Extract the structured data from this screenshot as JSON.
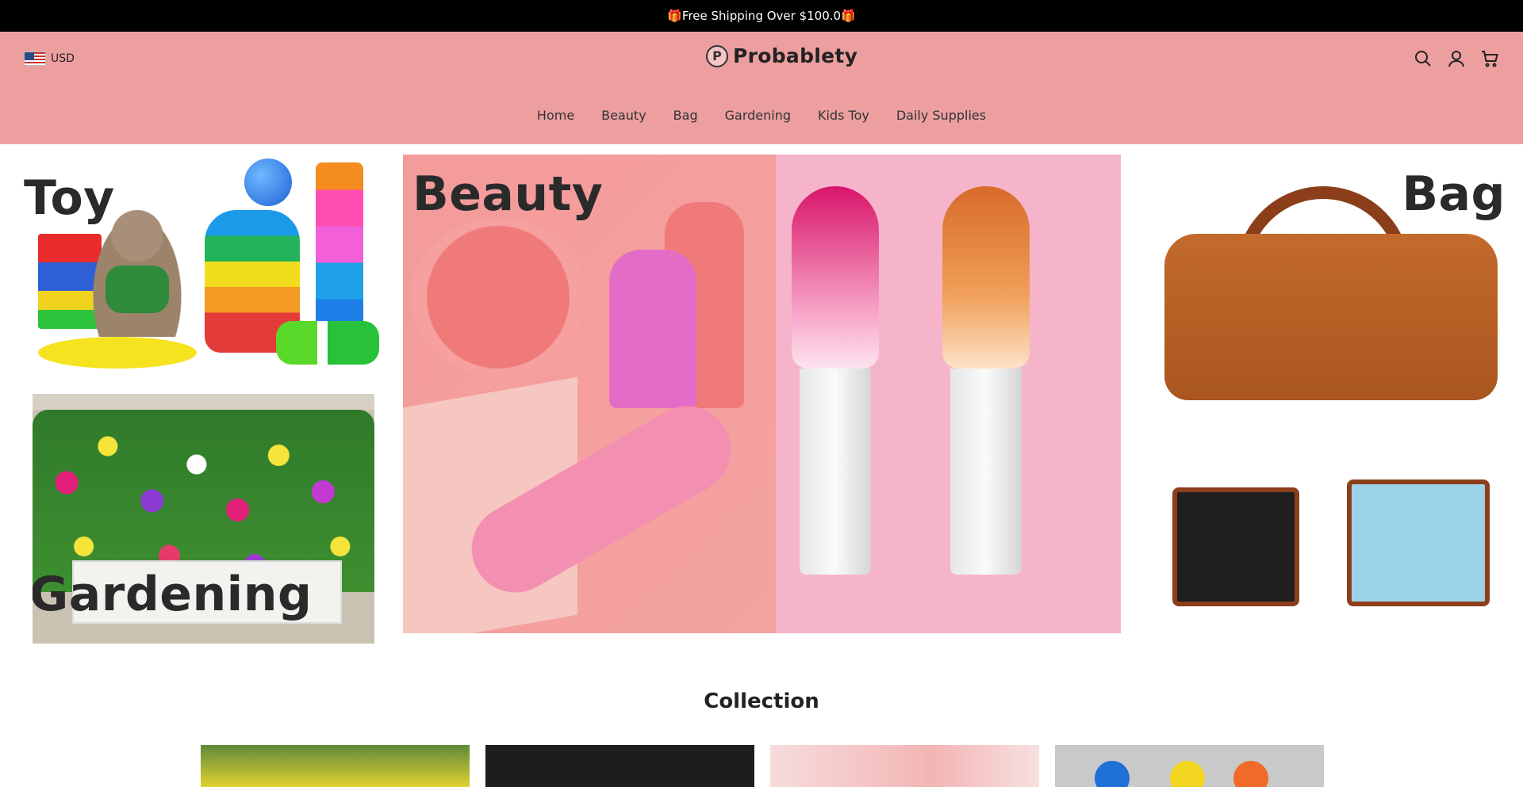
{
  "announcement": {
    "text": "🎁Free Shipping Over $100.0🎁"
  },
  "header": {
    "currency": "USD",
    "logo_mark": "P",
    "logo_text": "Probablety",
    "icons": [
      "search-icon",
      "account-icon",
      "cart-icon"
    ]
  },
  "nav": {
    "items": [
      "Home",
      "Beauty",
      "Bag",
      "Gardening",
      "Kids Toy",
      "Daily Supplies"
    ]
  },
  "tiles": {
    "toy": "Toy",
    "gardening": "Gardening",
    "beauty": "Beauty",
    "bag": "Bag"
  },
  "collection": {
    "title": "Collection"
  },
  "colors": {
    "header_bg": "#ed9fa0",
    "announcement_bg": "#000000"
  }
}
